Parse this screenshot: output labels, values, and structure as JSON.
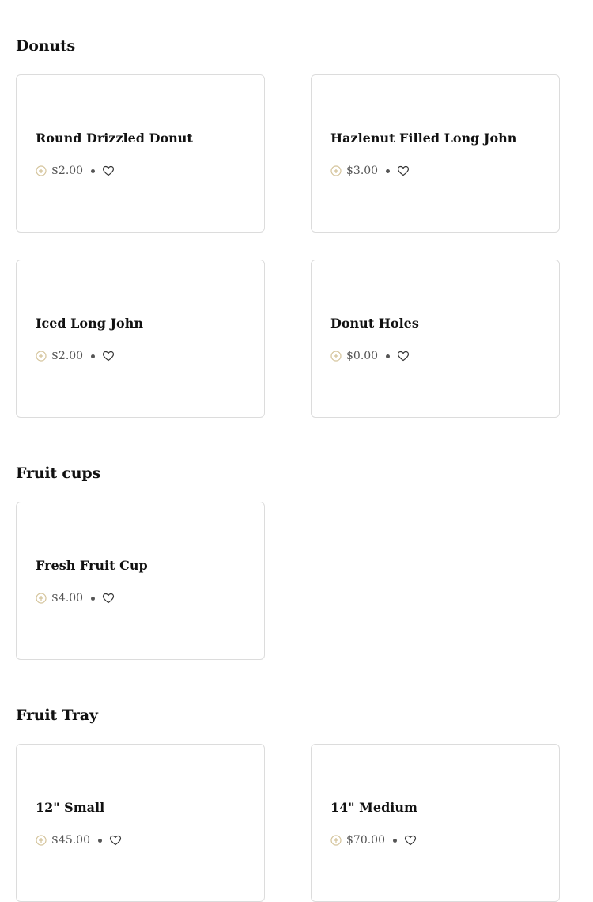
{
  "colors": {
    "accent_plus": "#d4c39a",
    "card_border": "#dcdcdc",
    "text": "#111111",
    "muted": "#555555"
  },
  "icons": {
    "add": "add-circle-icon",
    "favorite": "heart-outline-icon",
    "separator": "dot-separator"
  },
  "sections": [
    {
      "title": "Donuts",
      "items": [
        {
          "name": "Round Drizzled Donut",
          "price": "$2.00"
        },
        {
          "name": "Hazlenut Filled Long John",
          "price": "$3.00"
        },
        {
          "name": "Iced Long John",
          "price": "$2.00"
        },
        {
          "name": "Donut Holes",
          "price": "$0.00"
        }
      ]
    },
    {
      "title": "Fruit cups",
      "items": [
        {
          "name": "Fresh Fruit Cup",
          "price": "$4.00"
        }
      ]
    },
    {
      "title": "Fruit Tray",
      "items": [
        {
          "name": "12\" Small",
          "price": "$45.00"
        },
        {
          "name": "14\" Medium",
          "price": "$70.00"
        }
      ]
    }
  ]
}
